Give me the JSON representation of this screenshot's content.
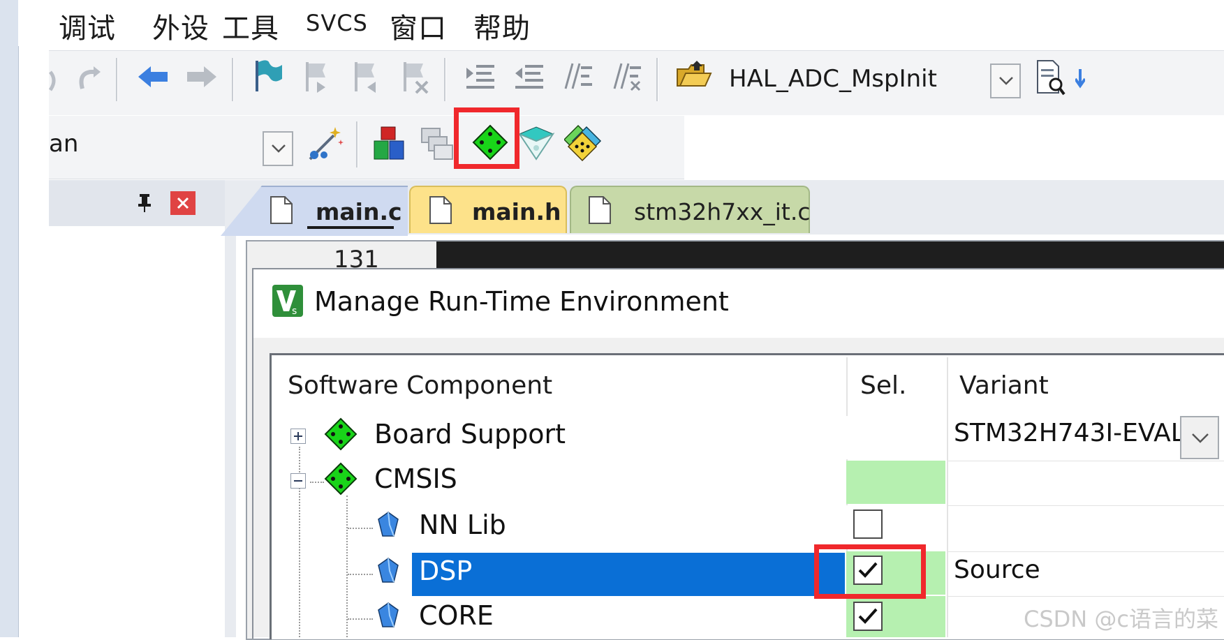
{
  "menu": {
    "items": [
      "调试",
      "外设",
      "工具",
      "SVCS",
      "窗口",
      "帮助"
    ]
  },
  "toolbar": {
    "function_combo_value": "HAL_ADC_MspInit",
    "target_combo_value": "an"
  },
  "tabs": [
    {
      "label": "main.c",
      "color": "#cfdaf0",
      "active": true
    },
    {
      "label": "main.h",
      "color": "#fde28a",
      "active": false
    },
    {
      "label": "stm32h7xx_it.c",
      "color": "#c7d9a8",
      "active": false
    }
  ],
  "editor": {
    "visible_line_number": "131"
  },
  "dialog": {
    "title": "Manage Run-Time Environment",
    "columns": {
      "component": "Software Component",
      "sel": "Sel.",
      "variant": "Variant"
    },
    "rows": [
      {
        "label": "Board Support",
        "level": 0,
        "expander": "+",
        "icon": "green-diamond-icon",
        "selected": null,
        "variant": "STM32H743I-EVAL",
        "sel_color": "#ffffff"
      },
      {
        "label": "CMSIS",
        "level": 0,
        "expander": "-",
        "icon": "green-diamond-icon",
        "selected": null,
        "variant": "",
        "sel_color": "#b6f0b0"
      },
      {
        "label": "NN Lib",
        "level": 1,
        "icon": "blue-gem-icon",
        "selected": false,
        "variant": "",
        "sel_color": "#ffffff"
      },
      {
        "label": "DSP",
        "level": 1,
        "icon": "blue-gem-icon",
        "selected": true,
        "variant": "Source",
        "sel_color": "#b6f0b0",
        "row_selected": true
      },
      {
        "label": "CORE",
        "level": 1,
        "icon": "blue-gem-icon",
        "selected": true,
        "variant": "",
        "sel_color": "#b6f0b0"
      }
    ]
  },
  "colors": {
    "selection_blue": "#0a6fd6",
    "highlight_red": "#f0282c",
    "green_sel": "#b6f0b0"
  },
  "watermark": "CSDN @c语言的菜"
}
